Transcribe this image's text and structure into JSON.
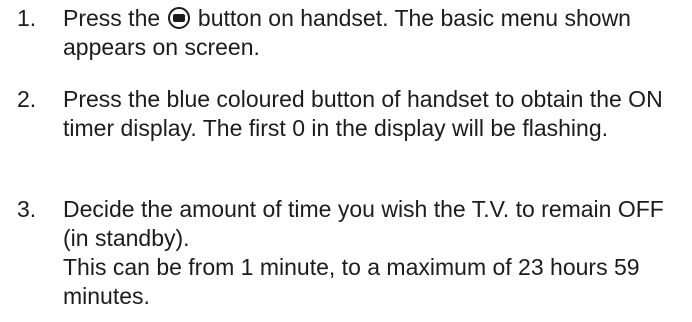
{
  "steps": [
    {
      "number": "1.",
      "text_before_icon": "Press the",
      "icon": "menu-button-icon",
      "text_after_icon": " button on handset. The basic menu shown appears on screen."
    },
    {
      "number": "2.",
      "text": "Press the blue coloured button of handset to obtain the ON timer display. The first 0 in the display will be flashing."
    },
    {
      "number": "3.",
      "lines": [
        "Decide the amount of time you wish the T.V. to remain OFF (in standby).",
        "This can be from 1 minute, to a maximum of 23 hours 59 minutes."
      ]
    }
  ]
}
